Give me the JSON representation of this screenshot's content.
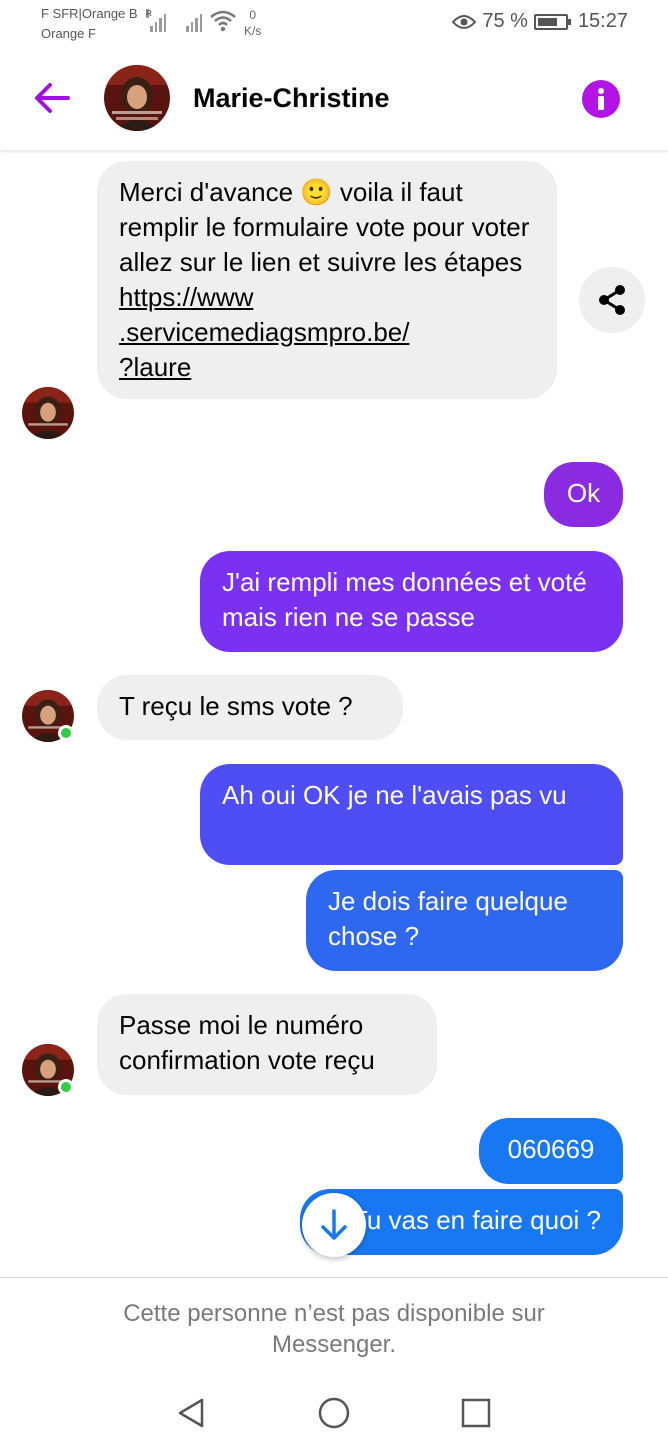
{
  "status_bar": {
    "carrier_line1": "F SFR|Orange B",
    "carrier_line2": "Orange F",
    "roaming_label": "R",
    "speed_value": "0",
    "speed_unit": "K/s",
    "battery": "75 %",
    "battery_level": 0.75,
    "time": "15:27"
  },
  "header": {
    "contact_name": "Marie-Christine",
    "accent_color": "#b214e6"
  },
  "messages": [
    {
      "sender": "them",
      "text_before": "Merci d'avance ",
      "emoji": "🙂",
      "text_after": " voila il faut remplir le formulaire vote pour voter allez sur le lien et suivre les étapes",
      "link": "https://www.servicemediagsmpro.be/?laure",
      "link_line1": "https://www",
      "link_line2": ".servicemediagsmpro.be/",
      "link_line3": "?laure"
    },
    {
      "sender": "me",
      "text": "Ok",
      "color": "#8a2be2"
    },
    {
      "sender": "me",
      "text": "J'ai rempli mes données et voté mais rien ne se passe",
      "color": "#7a31f2"
    },
    {
      "sender": "them",
      "text": "T reçu le sms vote ?"
    },
    {
      "sender": "me",
      "text": "Ah oui OK je ne l'avais pas vu",
      "color": "#4f4df4"
    },
    {
      "sender": "me",
      "text": "Je dois faire quelque chose ?",
      "color": "#2f68f0"
    },
    {
      "sender": "them",
      "text": "Passe moi le numéro confirmation vote reçu"
    },
    {
      "sender": "me",
      "text": "060669",
      "color": "#1877f2"
    },
    {
      "sender": "me",
      "text": "Tu vas en faire quoi ?",
      "color": "#1877f2"
    }
  ],
  "footer": {
    "notice": "Cette personne n’est pas disponible sur Messenger."
  },
  "icons": {
    "back": "arrow-left-icon",
    "info": "info-icon",
    "share": "share-icon",
    "scroll_down": "arrow-down-icon",
    "nav_back": "triangle-back-icon",
    "nav_home": "circle-home-icon",
    "nav_recents": "square-recents-icon"
  }
}
